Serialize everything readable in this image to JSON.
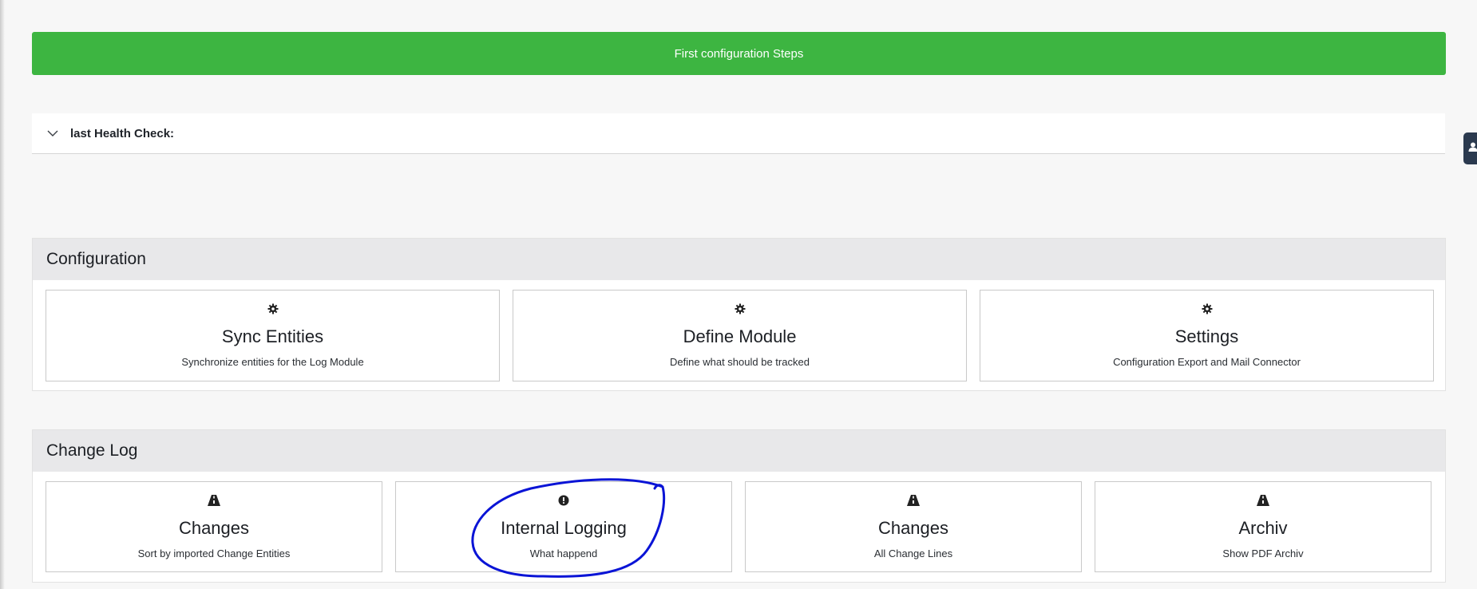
{
  "top_button": {
    "label": "First configuration Steps"
  },
  "health": {
    "label": "last Health Check:",
    "icon": "chevron-down-icon"
  },
  "configuration": {
    "title": "Configuration",
    "cards": [
      {
        "icon": "gear-icon",
        "title": "Sync Entities",
        "subtitle": "Synchronize entities for the Log Module"
      },
      {
        "icon": "gear-icon",
        "title": "Define Module",
        "subtitle": "Define what should be tracked"
      },
      {
        "icon": "gear-icon",
        "title": "Settings",
        "subtitle": "Configuration Export and Mail Connector"
      }
    ]
  },
  "change_log": {
    "title": "Change Log",
    "cards": [
      {
        "icon": "road-icon",
        "title": "Changes",
        "subtitle": "Sort by imported Change Entities"
      },
      {
        "icon": "exclamation-circle-icon",
        "title": "Internal Logging",
        "subtitle": "What happend"
      },
      {
        "icon": "road-icon",
        "title": "Changes",
        "subtitle": "All Change Lines"
      },
      {
        "icon": "road-icon",
        "title": "Archiv",
        "subtitle": "Show PDF Archiv"
      }
    ]
  },
  "side_tab": {
    "icon": "user-icon"
  },
  "colors": {
    "accent_green": "#3db541",
    "header_gray": "#e8e8ea",
    "annotation_blue": "#0a14d6",
    "side_tab": "#2b3a4f"
  }
}
